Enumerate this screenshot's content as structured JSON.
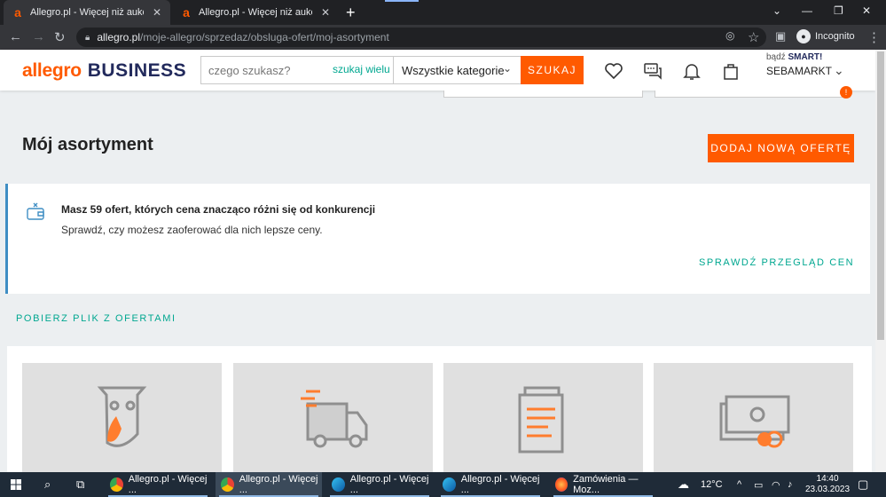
{
  "browser": {
    "tabs": [
      {
        "favicon": "a",
        "title": "Allegro.pl - Więcej niż aukcje. Na"
      },
      {
        "favicon": "a",
        "title": "Allegro.pl - Więcej niż aukcje. Na"
      }
    ],
    "new_tab": "+",
    "url_host": "allegro.pl",
    "url_path": "/moje-allegro/sprzedaz/obsluga-ofert/moj-asortyment",
    "profile": "Incognito"
  },
  "header": {
    "logo_allegro": "allegro",
    "logo_business": "BUSINESS",
    "search_placeholder": "czego szukasz?",
    "search_many": "szukaj wielu",
    "category": "Wszystkie kategorie",
    "search_button": "SZUKAJ",
    "smart_prefix": "bądź",
    "smart_label": "SMART!",
    "username": "SEBAMARKT"
  },
  "main": {
    "badge": "!",
    "title": "Mój asortyment",
    "add_offer": "DODAJ NOWĄ OFERTĘ",
    "notice_heading": "Masz 59 ofert, których cena znacząco różni się od konkurencji",
    "notice_text": "Sprawdź, czy możesz zaoferować dla nich lepsze ceny.",
    "notice_link": "SPRAWDŹ PRZEGLĄD CEN",
    "download_link": "POBIERZ PLIK Z OFERTAMI"
  },
  "taskbar": {
    "items": [
      {
        "label": "Allegro.pl - Więcej ..."
      },
      {
        "label": "Allegro.pl - Więcej ..."
      },
      {
        "label": "Allegro.pl - Więcej ..."
      },
      {
        "label": "Allegro.pl - Więcej ..."
      },
      {
        "label": "Zamówienia — Moz..."
      }
    ],
    "temperature": "12°C",
    "time": "14:40",
    "date": "23.03.2023"
  },
  "colors": {
    "accent": "#ff5a00",
    "brand_navy": "#222a5c",
    "teal": "#00a790",
    "notice_border": "#3f8ec4"
  }
}
